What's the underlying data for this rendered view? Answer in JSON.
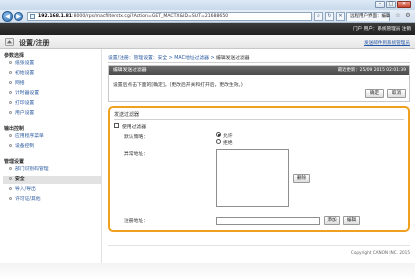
{
  "browser": {
    "url_host": "192.168.1.81",
    "url_rest": ":8000/rps/macfilterstx.cgi?Action=GET_MACTX&ID=SUT=21688650",
    "tab_title": "远程用户界面：编辑发送过滤器",
    "back_glyph": "◀",
    "forward_glyph": "▶",
    "minimize_glyph": "–",
    "maximize_glyph": "□",
    "close_glyph": "✕"
  },
  "header": {
    "top_links": "门户 用户：系统管理员 注销",
    "portal_title": "设置/注册",
    "sub_link": "发送邮件到系统管理员"
  },
  "sidebar": {
    "sections": [
      {
        "title": "参数选择",
        "items": [
          "纸张设置",
          "初始设置",
          "网络",
          "计时器设置",
          "打印设置",
          "用户设置"
        ]
      },
      {
        "title": "输出控制",
        "items": [
          "应用程序菜单",
          "设备控制"
        ]
      },
      {
        "title": "管理设置",
        "items": [
          "部门识别码管理",
          "安全",
          "导入/导出",
          "许可证/其他"
        ]
      }
    ],
    "active_item": "安全"
  },
  "breadcrumb": {
    "items": [
      "设置/注册：管理设置：安全",
      "MAC地址过滤器",
      "编辑发送过滤器"
    ],
    "separator": " > "
  },
  "edit_panel": {
    "title": "编辑发送过滤器",
    "timestamp": "最近更新：25/09 2015 02:01:39",
    "message": "设置后点击下面的[确定]。(更改后开关和打开后，更改生效。)",
    "ok_label": "确定",
    "cancel_label": "取消"
  },
  "filter_panel": {
    "title": "发送过滤器",
    "use_filter_label": "使用过滤器",
    "use_filter_checked": false,
    "default_policy_label": "默认策略：",
    "policy_allow_label": "允许",
    "policy_reject_label": "拒绝",
    "selected_policy": "允许",
    "exception_label": "异常地址：",
    "exception_addresses": [],
    "delete_label": "删除",
    "register_label": "注册地址：",
    "register_value": "",
    "add_label": "添加",
    "edit_label": "编辑"
  },
  "footer": {
    "copyright": "Copyright CANON INC. 2015"
  },
  "colors": {
    "header_bg": "#2a2a2a",
    "accent_orange": "#f0a020",
    "link_blue": "#2a5aa0",
    "panel_header": "#595959"
  }
}
